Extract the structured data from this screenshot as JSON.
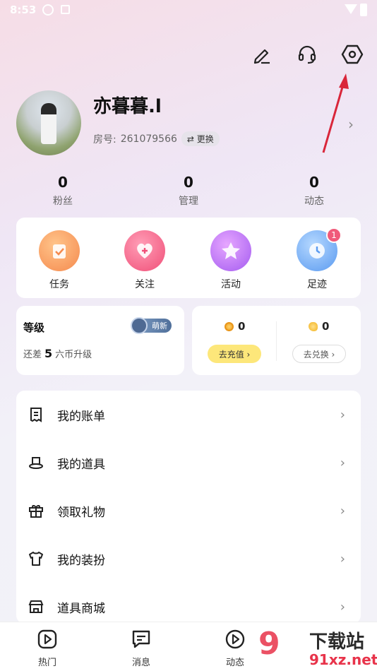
{
  "status_bar": {
    "time": "8:53"
  },
  "profile": {
    "username": "亦暮暮.l",
    "room_label": "房号:",
    "room_number": "261079566",
    "swap_label": "⇄ 更换"
  },
  "stats": [
    {
      "value": "0",
      "label": "粉丝"
    },
    {
      "value": "0",
      "label": "管理"
    },
    {
      "value": "0",
      "label": "动态"
    }
  ],
  "quick": [
    {
      "label": "任务",
      "icon": "task-icon"
    },
    {
      "label": "关注",
      "icon": "heart-icon"
    },
    {
      "label": "活动",
      "icon": "star-icon"
    },
    {
      "label": "足迹",
      "icon": "clock-icon",
      "badge": "1"
    }
  ],
  "level": {
    "title": "等级",
    "tag": "萌新",
    "prefix": "还差",
    "amount": "5",
    "suffix": "六币升级"
  },
  "wallet": {
    "coin_value": "0",
    "recharge": "去充值 ›",
    "bean_value": "0",
    "exchange": "去兑换 ›"
  },
  "menu": [
    {
      "label": "我的账单",
      "icon": "bill-icon"
    },
    {
      "label": "我的道具",
      "icon": "hat-icon"
    },
    {
      "label": "领取礼物",
      "icon": "gift-icon"
    },
    {
      "label": "我的装扮",
      "icon": "shirt-icon"
    },
    {
      "label": "道具商城",
      "icon": "store-icon"
    }
  ],
  "tabs": [
    {
      "label": "热门",
      "icon": "play-icon"
    },
    {
      "label": "消息",
      "icon": "message-icon"
    },
    {
      "label": "动态",
      "icon": "play-circle-icon"
    }
  ],
  "watermark": {
    "brand": "下载站",
    "site": "91xz.net"
  },
  "colors": {
    "accent_pink": "#f05a7a",
    "arrow_red": "#d9263a",
    "recharge_yellow": "#fde77a"
  }
}
